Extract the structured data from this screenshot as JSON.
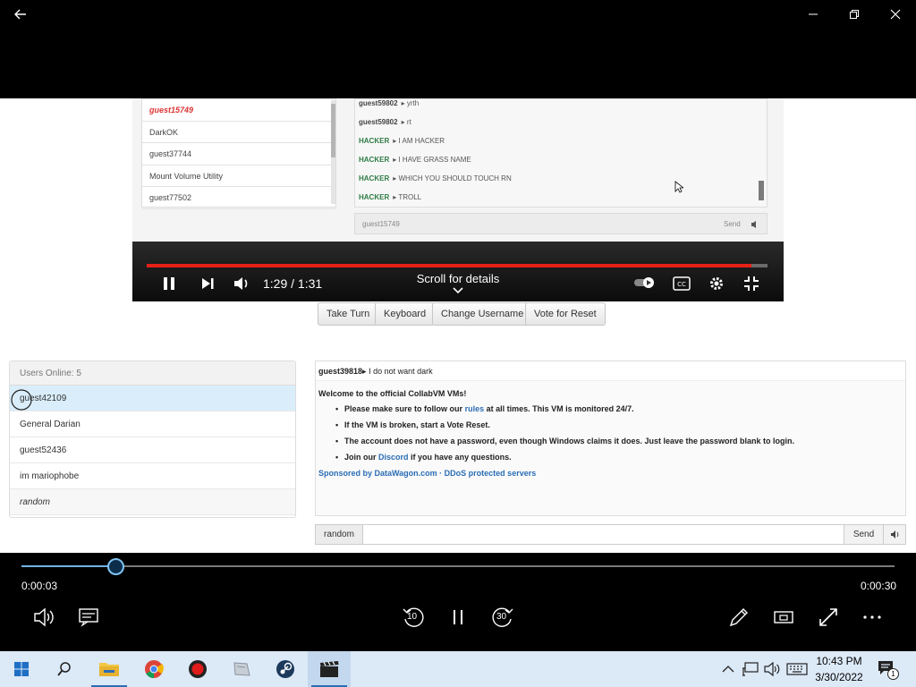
{
  "window": {
    "back": "back-arrow",
    "minimize": "minimize",
    "restore": "restore",
    "close": "close"
  },
  "inner_video": {
    "userlist": [
      "guest15749",
      "DarkOK",
      "guest37744",
      "Mount Volume Utility",
      "guest77502"
    ],
    "chat": [
      {
        "user": "guest59802",
        "text": "yrth",
        "hacker": false
      },
      {
        "user": "guest59802",
        "text": "rt",
        "hacker": false
      },
      {
        "user": "HACKER",
        "text": "I AM HACKER",
        "hacker": true
      },
      {
        "user": "HACKER",
        "text": "I HAVE GRASS NAME",
        "hacker": true
      },
      {
        "user": "HACKER",
        "text": "WHICH YOU SHOULD TOUCH RN",
        "hacker": true
      },
      {
        "user": "HACKER",
        "text": "TROLL",
        "hacker": true
      }
    ],
    "input_name": "guest15749",
    "send": "Send",
    "time": "1:29 / 1:31",
    "scroll_text": "Scroll for details"
  },
  "vm_buttons": [
    "Take Turn",
    "Keyboard",
    "Change Username",
    "Vote for Reset"
  ],
  "users_panel": {
    "header": "Users Online: 5",
    "users": [
      "guest42109",
      "General Darian",
      "guest52436",
      "im mariophobe",
      "random"
    ]
  },
  "chat_panel": {
    "top_user": "guest39818",
    "top_msg": "I do not want dark",
    "welcome": "Welcome to the official CollabVM VMs!",
    "bullet1_pre": "Please make sure to follow our",
    "bullet1_link": "rules",
    "bullet1_post": "at all times. This VM is monitored 24/7.",
    "bullet2": "If the VM is broken, start a Vote Reset.",
    "bullet3": "The account does not have a password, even though Windows claims it does. Just leave the password blank to login.",
    "bullet4_pre": "Join our",
    "bullet4_link": "Discord",
    "bullet4_post": "if you have any questions.",
    "sponsor": "Sponsored by DataWagon.com · DDoS protected servers",
    "input_name": "random",
    "send": "Send"
  },
  "player": {
    "current_time": "0:00:03",
    "total_time": "0:00:30",
    "progress": 0.1,
    "skip_back": "10",
    "skip_forward": "30"
  },
  "taskbar": {
    "time": "10:43 PM",
    "date": "3/30/2022",
    "notifications": "1"
  },
  "colors": {
    "accent": "#6fb3e8",
    "taskbar": "#dce9f7",
    "link": "#2a6db5"
  }
}
